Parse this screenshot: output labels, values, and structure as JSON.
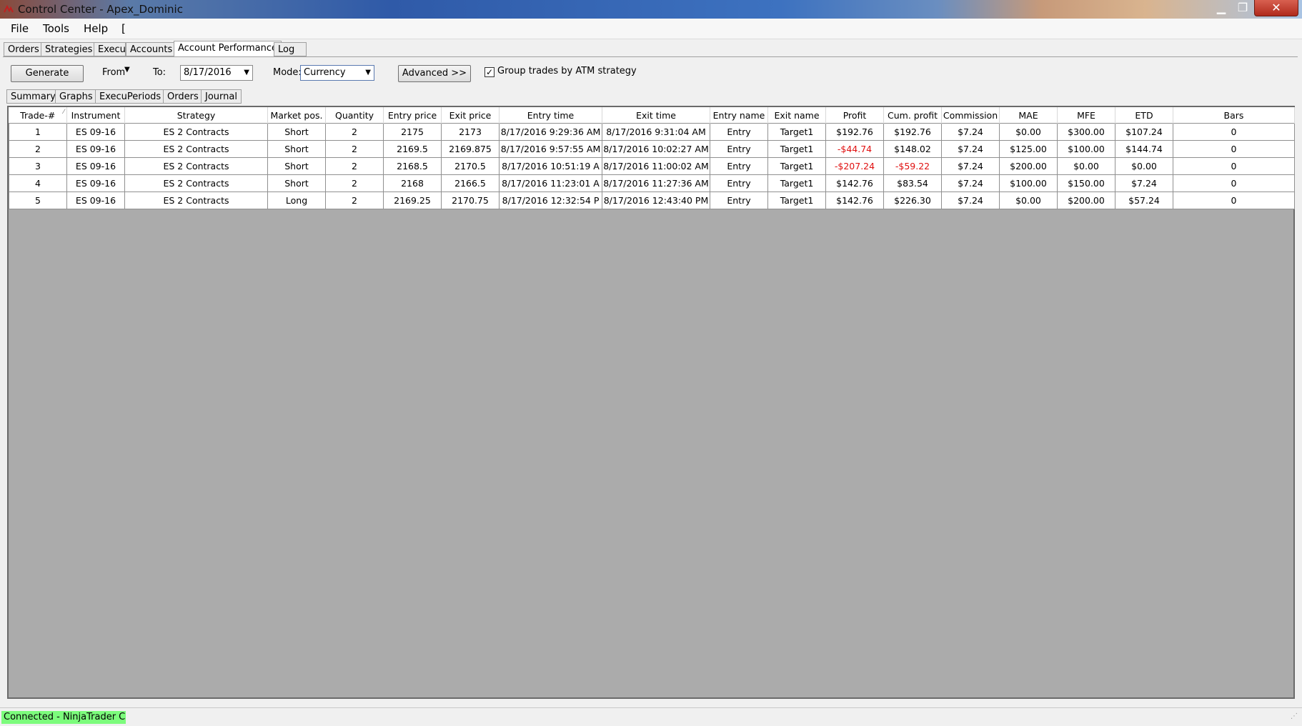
{
  "window": {
    "title": "Control Center - Apex_Dominic",
    "minimize_glyph": "▁",
    "maximize_glyph": "❐",
    "close_glyph": "✕"
  },
  "menu": [
    "File",
    "Tools",
    "Help",
    "["
  ],
  "main_tabs": [
    "Orders",
    "Strategies",
    "Execu",
    "Accounts",
    "Account Performance",
    "Log"
  ],
  "toolbar": {
    "generate_label": "Generate",
    "from_label": "From",
    "to_label": "To:",
    "to_date": "8/17/2016",
    "mode_label": "Mode:",
    "mode_value": "Currency",
    "advanced_label": "Advanced >>",
    "group_checkbox_checked": true,
    "group_checkbox_mark": "✓",
    "group_label": "Group trades by ATM strategy"
  },
  "sub_tabs": [
    "Summary",
    "Graphs",
    "ExecuPeriods",
    "Orders",
    "Journal"
  ],
  "table": {
    "columns": [
      "Trade-#",
      "Instrument",
      "Strategy",
      "Market pos.",
      "Quantity",
      "Entry price",
      "Exit price",
      "Entry time",
      "Exit time",
      "Entry name",
      "Exit name",
      "Profit",
      "Cum. profit",
      "Commission",
      "MAE",
      "MFE",
      "ETD",
      "Bars"
    ],
    "rows": [
      [
        "1",
        "ES 09-16",
        "ES 2 Contracts",
        "Short",
        "2",
        "2175",
        "2173",
        "8/17/2016 9:29:36 AM",
        "8/17/2016 9:31:04 AM",
        "Entry",
        "Target1",
        "$192.76",
        "$192.76",
        "$7.24",
        "$0.00",
        "$300.00",
        "$107.24",
        "0"
      ],
      [
        "2",
        "ES 09-16",
        "ES 2 Contracts",
        "Short",
        "2",
        "2169.5",
        "2169.875",
        "8/17/2016 9:57:55 AM",
        "8/17/2016 10:02:27 AM",
        "Entry",
        "Target1",
        "-$44.74",
        "$148.02",
        "$7.24",
        "$125.00",
        "$100.00",
        "$144.74",
        "0"
      ],
      [
        "3",
        "ES 09-16",
        "ES 2 Contracts",
        "Short",
        "2",
        "2168.5",
        "2170.5",
        "8/17/2016 10:51:19 A",
        "8/17/2016 11:00:02 AM",
        "Entry",
        "Target1",
        "-$207.24",
        "-$59.22",
        "$7.24",
        "$200.00",
        "$0.00",
        "$0.00",
        "0"
      ],
      [
        "4",
        "ES 09-16",
        "ES 2 Contracts",
        "Short",
        "2",
        "2168",
        "2166.5",
        "8/17/2016 11:23:01 A",
        "8/17/2016 11:27:36 AM",
        "Entry",
        "Target1",
        "$142.76",
        "$83.54",
        "$7.24",
        "$100.00",
        "$150.00",
        "$7.24",
        "0"
      ],
      [
        "5",
        "ES 09-16",
        "ES 2 Contracts",
        "Long",
        "2",
        "2169.25",
        "2170.75",
        "8/17/2016 12:32:54 P",
        "8/17/2016 12:43:40 PM",
        "Entry",
        "Target1",
        "$142.76",
        "$226.30",
        "$7.24",
        "$0.00",
        "$200.00",
        "$57.24",
        "0"
      ]
    ],
    "negative_color": "#e01010"
  },
  "status": {
    "text": "Connected - NinjaTrader C",
    "color": "#7cfc7c"
  }
}
